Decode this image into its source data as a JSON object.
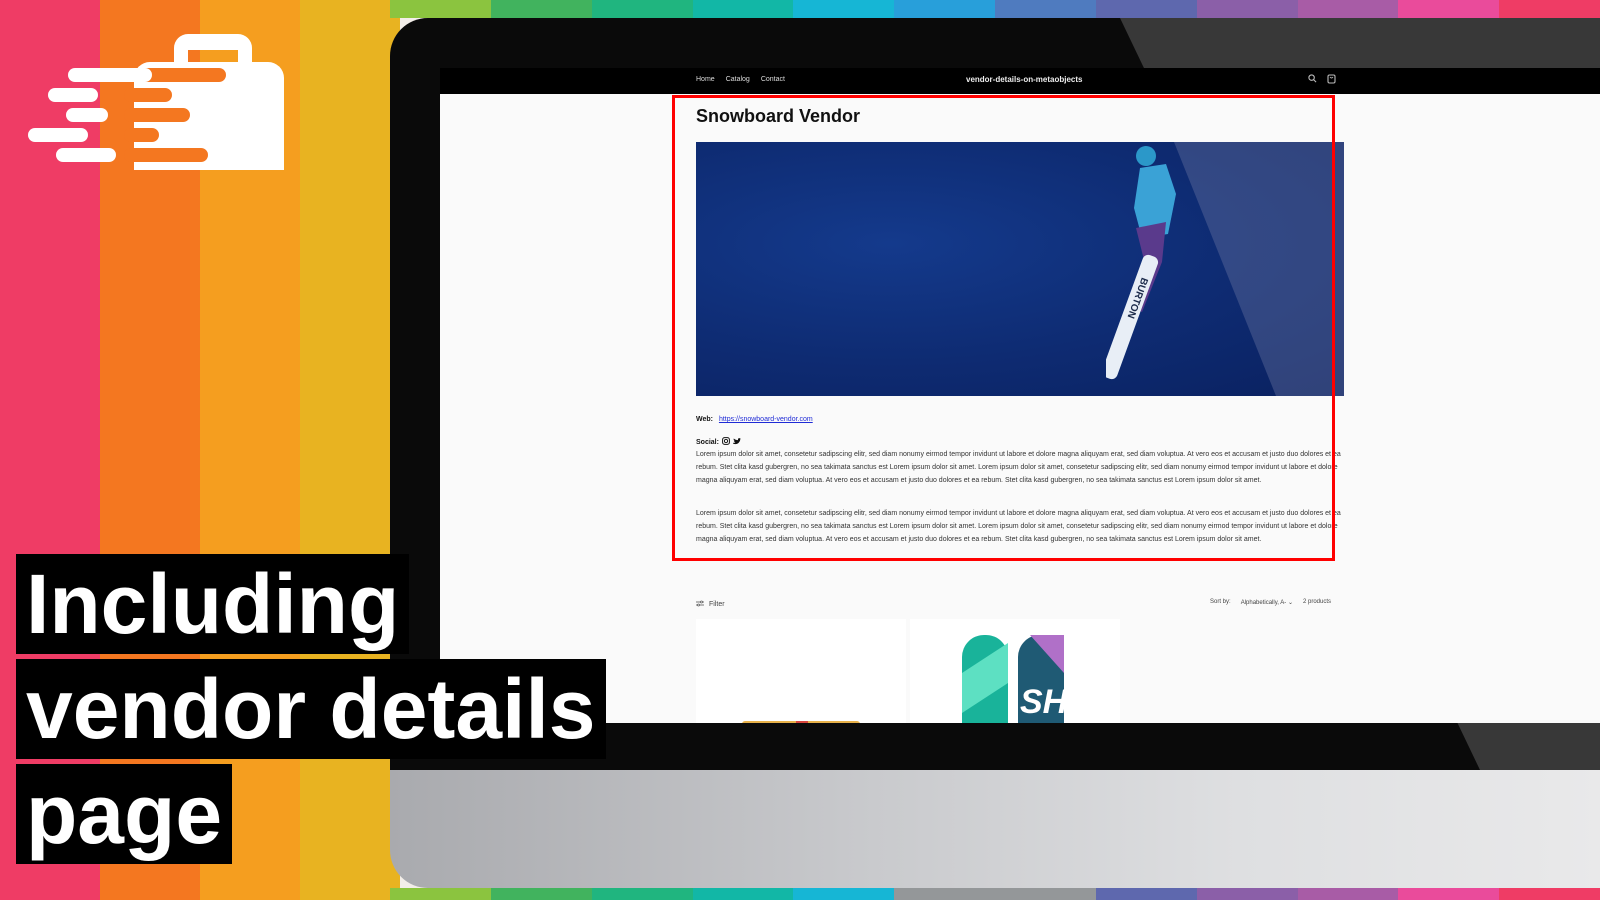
{
  "background": {
    "stripes": [
      "#ef3c65",
      "#f47720",
      "#f59e1f",
      "#e8b321"
    ],
    "top_stripes": [
      "#8bc43f",
      "#41b35e",
      "#20b57f",
      "#12b7a6",
      "#16b6d5",
      "#289fda",
      "#4f7bbf",
      "#5e68ae",
      "#8b5fa8",
      "#a85ca6",
      "#ea4b9b",
      "#ef3c65"
    ],
    "bottom_stripes": [
      "#8bc43f",
      "#41b35e",
      "#20b57f",
      "#12b7a6",
      "#16b6d5",
      "#949799",
      "#949799",
      "#5e68ae",
      "#8b5fa8",
      "#a85ca6",
      "#ea4b9b",
      "#ef3c65"
    ],
    "logo_icon": "briefcase-speed-icon"
  },
  "headline": {
    "line1": "Including",
    "line2": "vendor details",
    "line3": "page"
  },
  "store": {
    "nav": {
      "links": [
        "Home",
        "Catalog",
        "Contact"
      ],
      "site_title": "vendor-details-on-metaobjects",
      "icons": [
        "search-icon",
        "cart-icon"
      ]
    },
    "vendor": {
      "title": "Snowboard Vendor",
      "hero_icon": "snowboarder-image",
      "board_text": "BURTON",
      "web_label": "Web:",
      "web_url": "https://snowboard-vendor.com",
      "social_label": "Social:",
      "social_icons": [
        "instagram-icon",
        "twitter-icon"
      ],
      "paragraphs": [
        "Lorem ipsum dolor sit amet, consetetur sadipscing elitr, sed diam nonumy eirmod tempor invidunt ut labore et dolore magna aliquyam erat, sed diam voluptua. At vero eos et accusam et justo duo dolores et ea rebum. Stet clita kasd gubergren, no sea takimata sanctus est Lorem ipsum dolor sit amet. Lorem ipsum dolor sit amet, consetetur sadipscing elitr, sed diam nonumy eirmod tempor invidunt ut labore et dolore magna aliquyam erat, sed diam voluptua. At vero eos et accusam et justo duo dolores et ea rebum. Stet clita kasd gubergren, no sea takimata sanctus est Lorem ipsum dolor sit amet.",
        "Lorem ipsum dolor sit amet, consetetur sadipscing elitr, sed diam nonumy eirmod tempor invidunt ut labore et dolore magna aliquyam erat, sed diam voluptua. At vero eos et accusam et justo duo dolores et ea rebum. Stet clita kasd gubergren, no sea takimata sanctus est Lorem ipsum dolor sit amet. Lorem ipsum dolor sit amet, consetetur sadipscing elitr, sed diam nonumy eirmod tempor invidunt ut labore et dolore magna aliquyam erat, sed diam voluptua. At vero eos et accusam et justo duo dolores et ea rebum. Stet clita kasd gubergren, no sea takimata sanctus est Lorem ipsum dolor sit amet."
      ],
      "highlight_color": "#ff0000"
    },
    "collection": {
      "filter_label": "Filter",
      "sort_label": "Sort by:",
      "sort_value": "Alphabetically, A-",
      "product_count": "2 products",
      "board_graphic_text": "SH"
    }
  }
}
